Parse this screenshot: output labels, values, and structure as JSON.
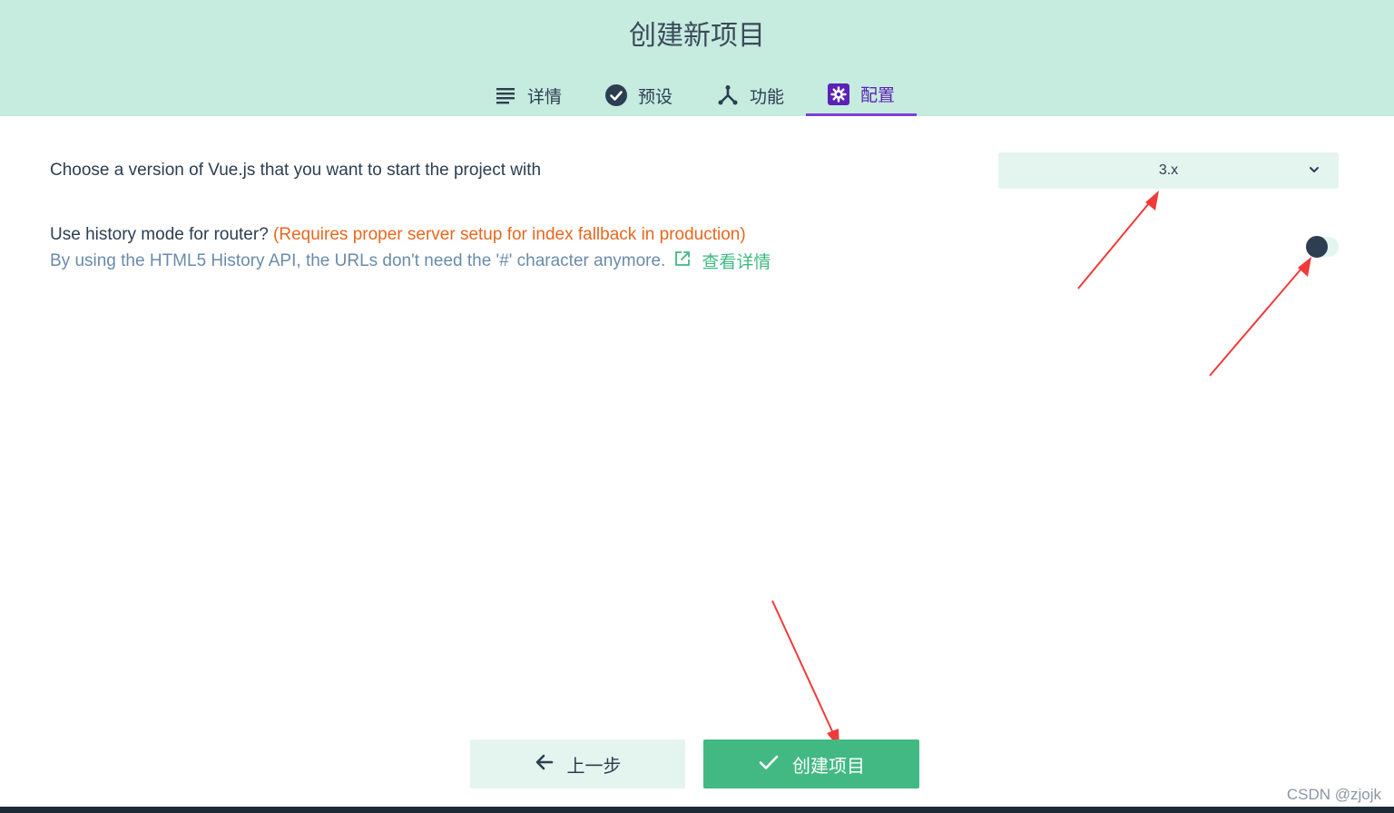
{
  "header": {
    "title": "创建新项目",
    "tabs": [
      {
        "label": "详情",
        "icon": "list-icon"
      },
      {
        "label": "预设",
        "icon": "check-circle-icon"
      },
      {
        "label": "功能",
        "icon": "fork-icon"
      },
      {
        "label": "配置",
        "icon": "gear-icon",
        "active": true
      }
    ]
  },
  "config": {
    "vue_version": {
      "question": "Choose a version of Vue.js that you want to start the project with",
      "selected": "3.x"
    },
    "history_mode": {
      "question": "Use history mode for router?",
      "warning": "(Requires proper server setup for index fallback in production)",
      "description": "By using the HTML5 History API, the URLs don't need the '#' character anymore.",
      "link_label": "查看详情",
      "enabled": false
    }
  },
  "actions": {
    "prev_label": "上一步",
    "create_label": "创建项目"
  },
  "watermark": "CSDN @zjojk",
  "colors": {
    "header_bg": "#c6ebdf",
    "accent_green": "#42b983",
    "active_tab": "#5b22b5",
    "warning": "#e8671e",
    "annotation_arrow": "#f03a3a"
  }
}
